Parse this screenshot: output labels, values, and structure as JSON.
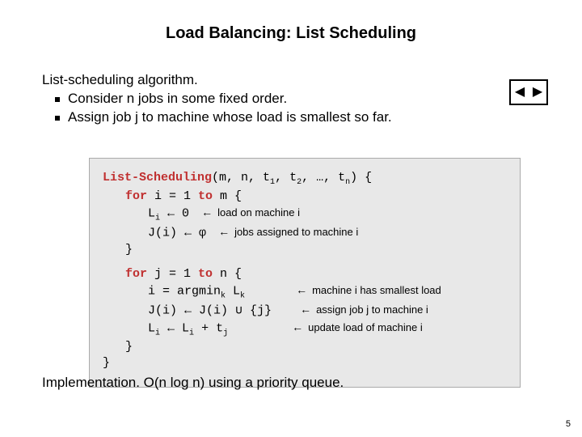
{
  "title": "Load Balancing:  List Scheduling",
  "intro": {
    "lead": "List-scheduling algorithm.",
    "bullets": [
      "Consider n jobs in some fixed order.",
      "Assign job j to machine whose load is smallest so far."
    ]
  },
  "code": {
    "fn_name": "List-Scheduling",
    "params_prefix": "(m, n, t",
    "params_mid": ")",
    "open_brace": " {",
    "for1_kw": "for",
    "for1_rest": " i = 1 ",
    "to_kw": "to",
    "for1_end": " m {",
    "line_Li": "L",
    "assign_arrow": " ← ",
    "zero": "0",
    "line_Ji": "J(i)",
    "phi": "φ",
    "close_brace": "}",
    "for2_rest": " j = 1 ",
    "for2_end": " n {",
    "argmin_line_a": "i = argmin",
    "argmin_sub": "k",
    "argmin_line_b": " L",
    "Jline_a": "J(i) ← J(i) ∪ {j}",
    "Lline_a": "L",
    "Lline_b": " ← L",
    "Lline_c": " + t",
    "sub_i": "i",
    "sub_j": "j",
    "sub_k": "k",
    "t_seq_1": "1",
    "t_seq_2": "2",
    "t_seq_n": "n",
    "dots": ", …, t"
  },
  "annotations": {
    "load_on": "load on machine i",
    "jobs_assigned": "jobs assigned to machine i",
    "smallest": "machine i has smallest load",
    "assign_job": "assign job j to machine i",
    "update": "update load of machine i"
  },
  "impl": {
    "lead": "Implementation.",
    "rest": "  O(n log n) using a priority queue."
  },
  "nav": {
    "prev": "◀",
    "next": "▶"
  },
  "page_number": "5"
}
